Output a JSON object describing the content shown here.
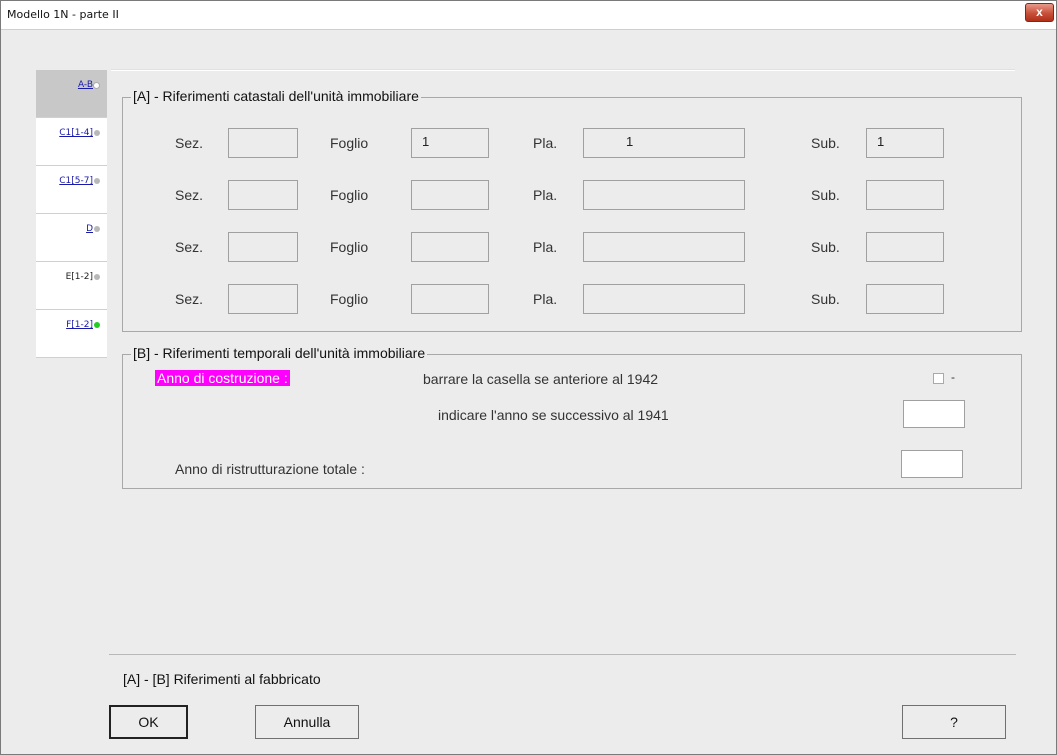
{
  "window": {
    "title": "Modello 1N  -   parte II",
    "close_symbol": "x"
  },
  "tabs": [
    {
      "label": "A-B",
      "status": "empty"
    },
    {
      "label": "C1[1-4]",
      "status": "gray"
    },
    {
      "label": "C1[5-7]",
      "status": "gray"
    },
    {
      "label": "D",
      "status": "gray"
    },
    {
      "label": "E[1-2]",
      "status": "gray"
    },
    {
      "label": "F[1-2]",
      "status": "green"
    }
  ],
  "section_a": {
    "title": "[A] - Riferimenti catastali dell'unità immobiliare",
    "labels": {
      "sez": "Sez.",
      "foglio": "Foglio",
      "pla": "Pla.",
      "sub": "Sub."
    },
    "rows": [
      {
        "sez": "",
        "foglio": "1",
        "pla": "1",
        "sub": "1"
      },
      {
        "sez": "",
        "foglio": "",
        "pla": "",
        "sub": ""
      },
      {
        "sez": "",
        "foglio": "",
        "pla": "",
        "sub": ""
      },
      {
        "sez": "",
        "foglio": "",
        "pla": "",
        "sub": ""
      }
    ]
  },
  "section_b": {
    "title": "[B] - Riferimenti temporali dell'unità immobiliare",
    "anno_costruzione": "Anno di costruzione :",
    "barrare": "barrare la casella se anteriore al 1942",
    "checkbox_suffix": "-",
    "indicare": "indicare l'anno se successivo al 1941",
    "anno_costruzione_value": "",
    "ristrutturazione": "Anno di ristrutturazione totale :",
    "ristrutturazione_value": ""
  },
  "footer": {
    "section_label": "[A] - [B] Riferimenti al fabbricato",
    "ok": "OK",
    "cancel": "Annulla",
    "help": "?"
  },
  "colors": {
    "highlight": "#ff00ff",
    "green_dot": "#22cc22",
    "close_button": "#c8503a"
  }
}
